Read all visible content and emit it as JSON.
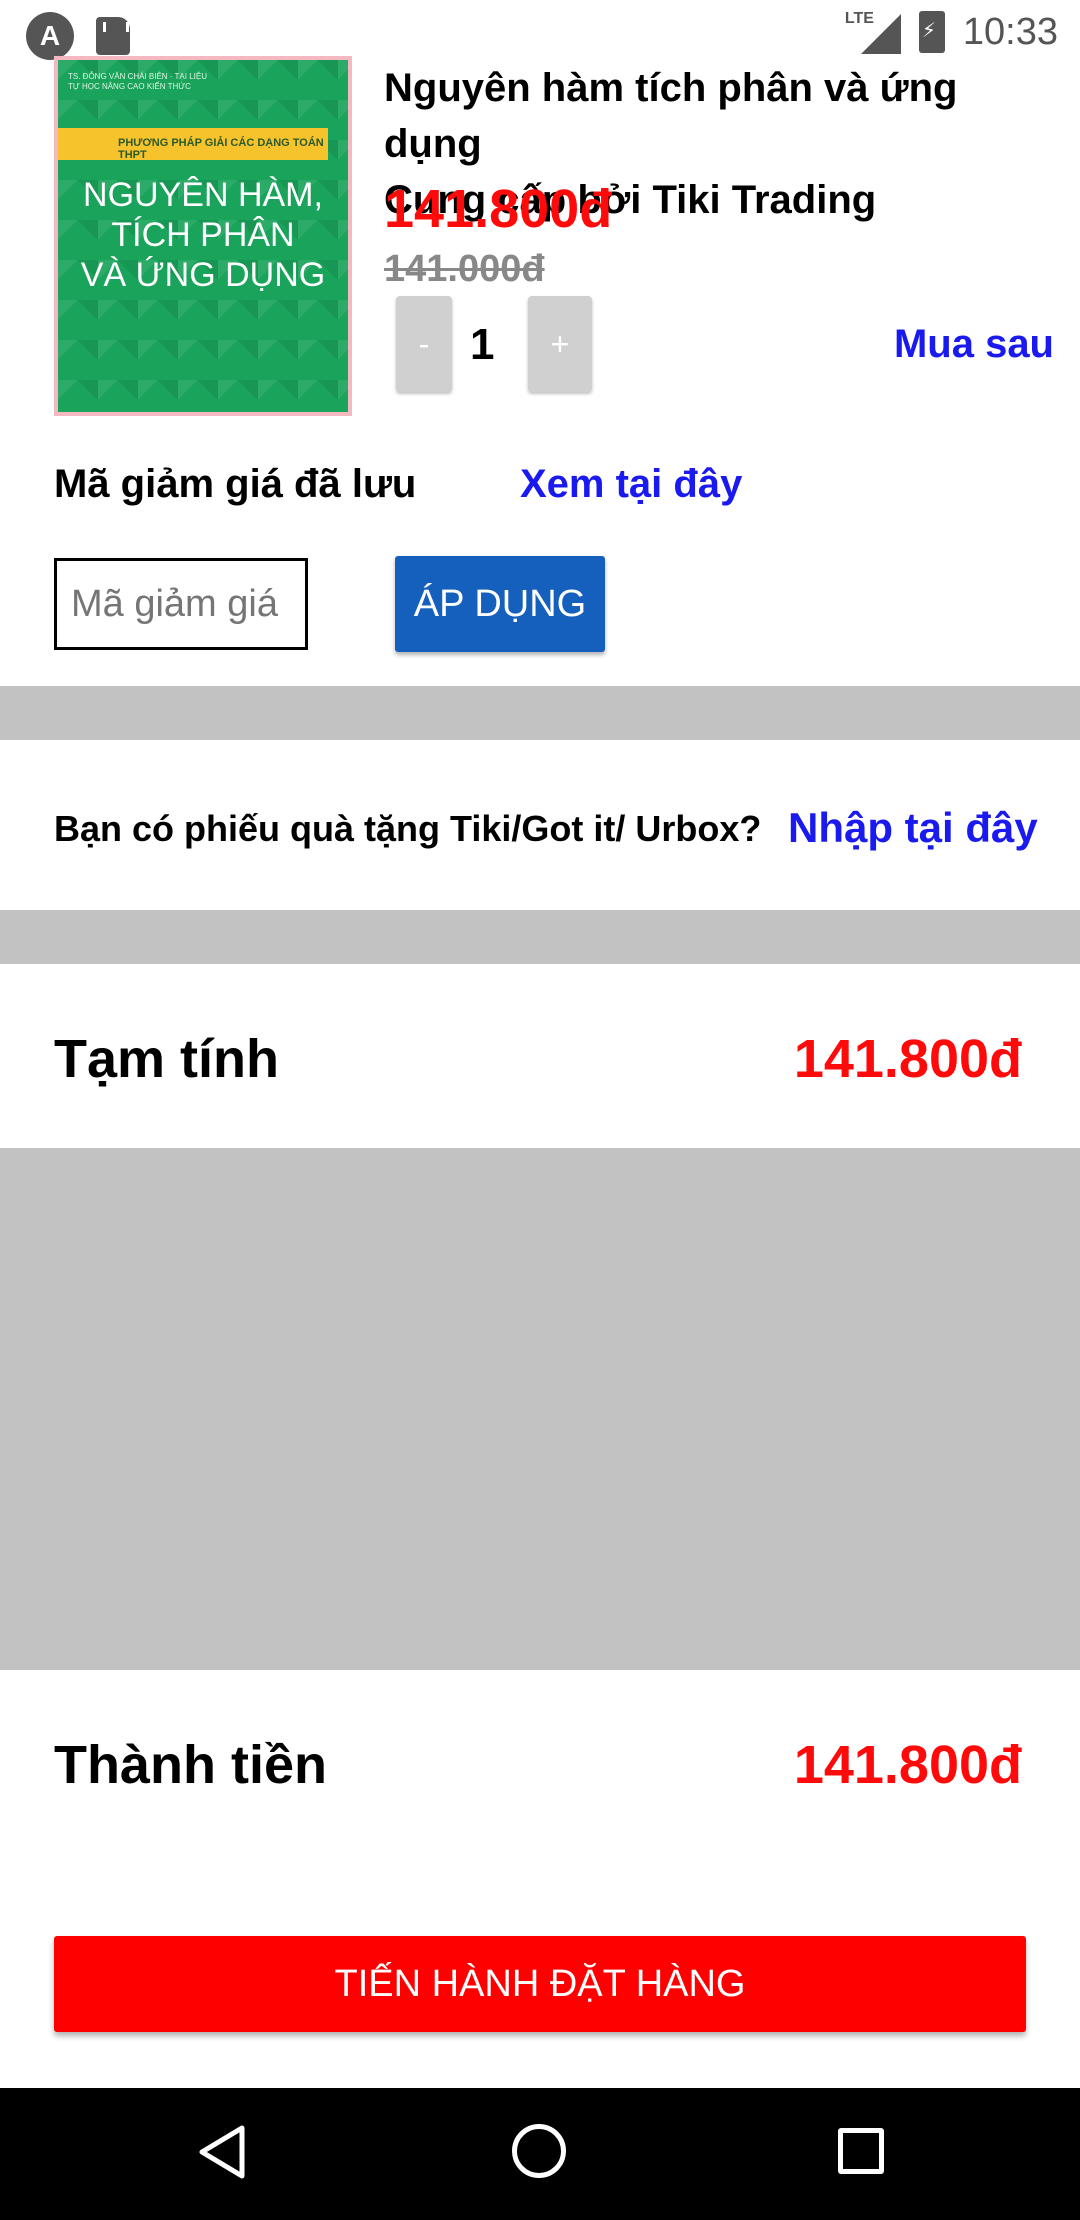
{
  "status_bar": {
    "app_icon": "A",
    "network": "LTE",
    "time": "10:33"
  },
  "product": {
    "cover_top_text": "TS. ĐỖNG VĂN CHÁI BIÊN · TẠI LIỆU TỰ HỌC NÂNG CAO KIẾN THỨC",
    "cover_band": "PHƯƠNG PHÁP GIẢI CÁC DẠNG TOÁN THPT",
    "cover_title_1": "NGUYÊN HÀM,",
    "cover_title_2": "TÍCH PHÂN",
    "cover_title_3": "VÀ ỨNG DỤNG",
    "title": "Nguyên hàm tích phân và ứng dụng",
    "seller": "Cung cấp bởi Tiki Trading",
    "price": "141.800đ",
    "old_price": "141.000đ",
    "qty_minus": "-",
    "quantity": "1",
    "qty_plus": "+",
    "buy_later": "Mua sau"
  },
  "coupon": {
    "label": "Mã giảm giá đã lưu",
    "view_link": "Xem tại đây",
    "input_placeholder": "Mã giảm giá",
    "apply_label": "ÁP DỤNG"
  },
  "gift": {
    "text": "Bạn có phiếu quà tặng Tiki/Got it/ Urbox?",
    "link": "Nhập tại đây"
  },
  "summary": {
    "subtotal_label": "Tạm tính",
    "subtotal_value": "141.800đ",
    "total_label": "Thành tiền",
    "total_value": "141.800đ",
    "order_button": "TIẾN HÀNH ĐẶT HÀNG"
  },
  "colors": {
    "price_red": "#ff0a0a",
    "link_blue": "#1a1aee",
    "apply_blue": "#1560bd",
    "order_red": "#ff0000",
    "separator_gray": "#c2c2c2"
  }
}
